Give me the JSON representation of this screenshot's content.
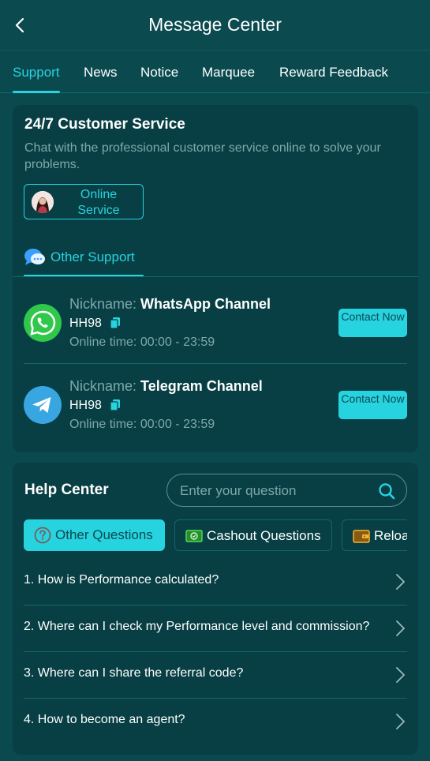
{
  "header": {
    "title": "Message Center"
  },
  "tabs": [
    {
      "label": "Support"
    },
    {
      "label": "News"
    },
    {
      "label": "Notice"
    },
    {
      "label": "Marquee"
    },
    {
      "label": "Reward Feedback"
    }
  ],
  "customer_service": {
    "title": "24/7 Customer Service",
    "description": "Chat with the professional customer service online to solve your problems.",
    "online_button": "Online Service"
  },
  "other_support": {
    "label": "Other Support",
    "contacts": [
      {
        "nickname_label": "Nickname:",
        "name": "WhatsApp Channel",
        "id": "HH98",
        "time": "Online time: 00:00 - 23:59",
        "button": "Contact Now",
        "icon": "whatsapp-icon"
      },
      {
        "nickname_label": "Nickname:",
        "name": "Telegram Channel",
        "id": "HH98",
        "time": "Online time: 00:00 - 23:59",
        "button": "Contact Now",
        "icon": "telegram-icon"
      }
    ]
  },
  "help_center": {
    "title": "Help Center",
    "search_placeholder": "Enter your question",
    "categories": [
      {
        "label": "Other Questions",
        "icon": "question-icon"
      },
      {
        "label": "Cashout Questions",
        "icon": "cash-icon"
      },
      {
        "label": "Reload Questions",
        "icon": "wallet-icon"
      }
    ],
    "faqs": [
      "1. How is Performance calculated?",
      "2. Where can I check my Performance level and commission?",
      "3. Where can I share the referral code?",
      "4. How to become an agent?"
    ]
  },
  "colors": {
    "accent": "#28d3e0",
    "background": "#0a4a4f",
    "card": "#073f44",
    "muted_text": "#7fa8ab"
  }
}
